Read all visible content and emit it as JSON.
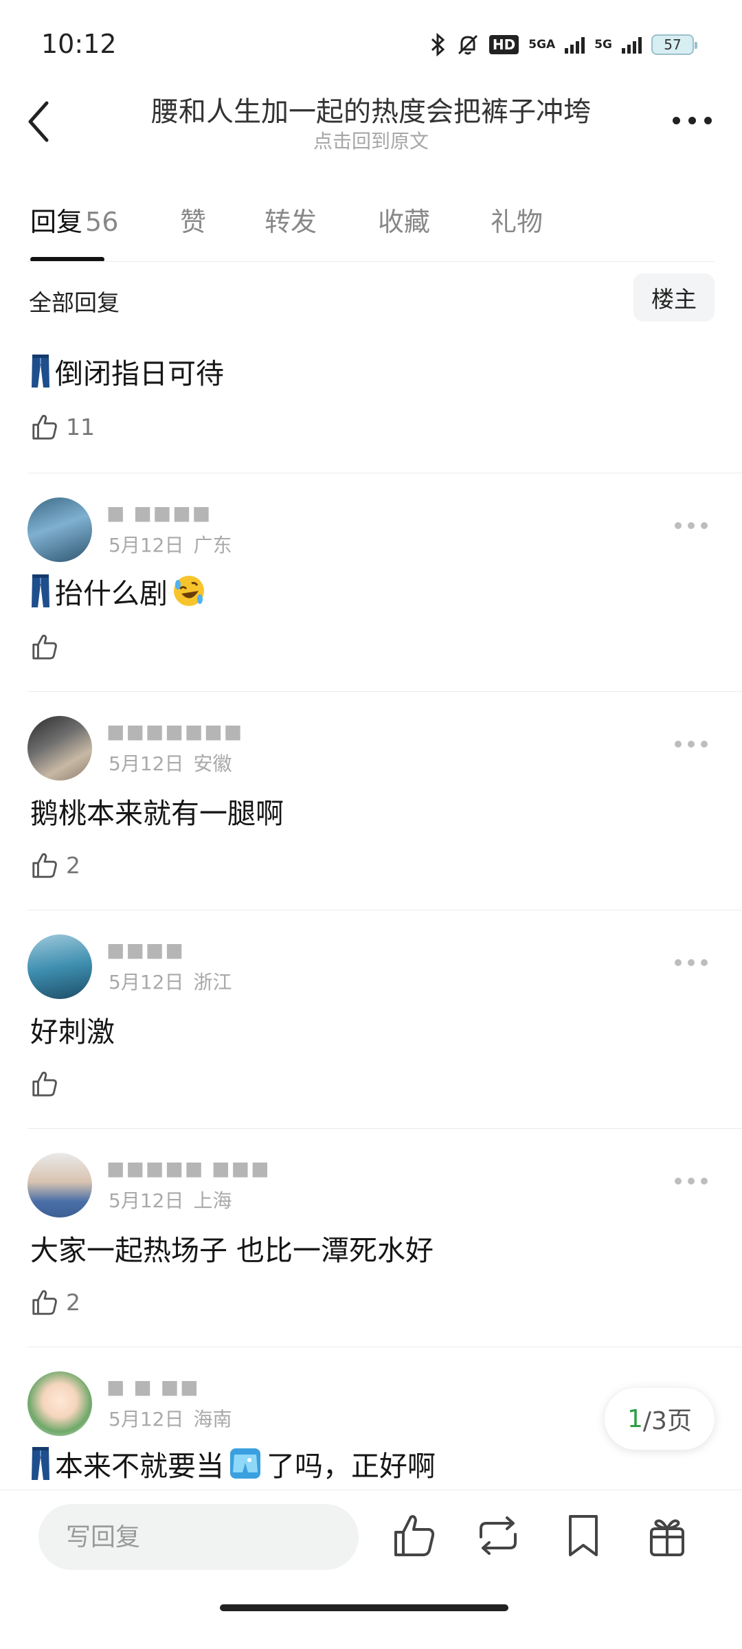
{
  "status_bar": {
    "time": "10:12",
    "hd_badge": "HD",
    "network_1": "5GA",
    "network_2": "5G",
    "battery": "57"
  },
  "header": {
    "title": "腰和人生加一起的热度会把裤子冲垮",
    "subtitle": "点击回到原文"
  },
  "tabs": [
    {
      "label": "回复",
      "count": "56"
    },
    {
      "label": "赞"
    },
    {
      "label": "转发"
    },
    {
      "label": "收藏"
    },
    {
      "label": "礼物"
    }
  ],
  "filter": {
    "label": "全部回复",
    "owner_button": "楼主"
  },
  "comments": [
    {
      "username": "",
      "date": "",
      "location": "",
      "text": "倒闭指日可待",
      "likes": "11",
      "prefix_icon": "jeans-icon"
    },
    {
      "username": "■ ■■■■",
      "date": "5月12日",
      "location": "广东",
      "text": "抬什么剧",
      "likes": "",
      "prefix_icon": "jeans-icon",
      "suffix_icon": "rolling-laugh-icon"
    },
    {
      "username": "■■■■■■■",
      "date": "5月12日",
      "location": "安徽",
      "text": "鹅桃本来就有一腿啊",
      "likes": "2"
    },
    {
      "username": "■■■■",
      "date": "5月12日",
      "location": "浙江",
      "text": "好刺激",
      "likes": ""
    },
    {
      "username": "■■■■■ ■■■",
      "date": "5月12日",
      "location": "上海",
      "text": "大家一起热场子 也比一潭死水好",
      "likes": "2"
    },
    {
      "username": "■ ■ ■■",
      "date": "5月12日",
      "location": "海南",
      "text_part1": "本来不就要当",
      "text_part2": "了吗，正好啊",
      "prefix_icon": "jeans-icon",
      "middle_icon": "shorts-icon"
    }
  ],
  "pagination": {
    "current": "1",
    "total": "/3页"
  },
  "bottom_bar": {
    "reply_placeholder": "写回复"
  },
  "colors": {
    "accent_green": "#2f9e44",
    "jeans_blue": "#1f4e8c",
    "shorts_blue": "#3aa0e0"
  }
}
